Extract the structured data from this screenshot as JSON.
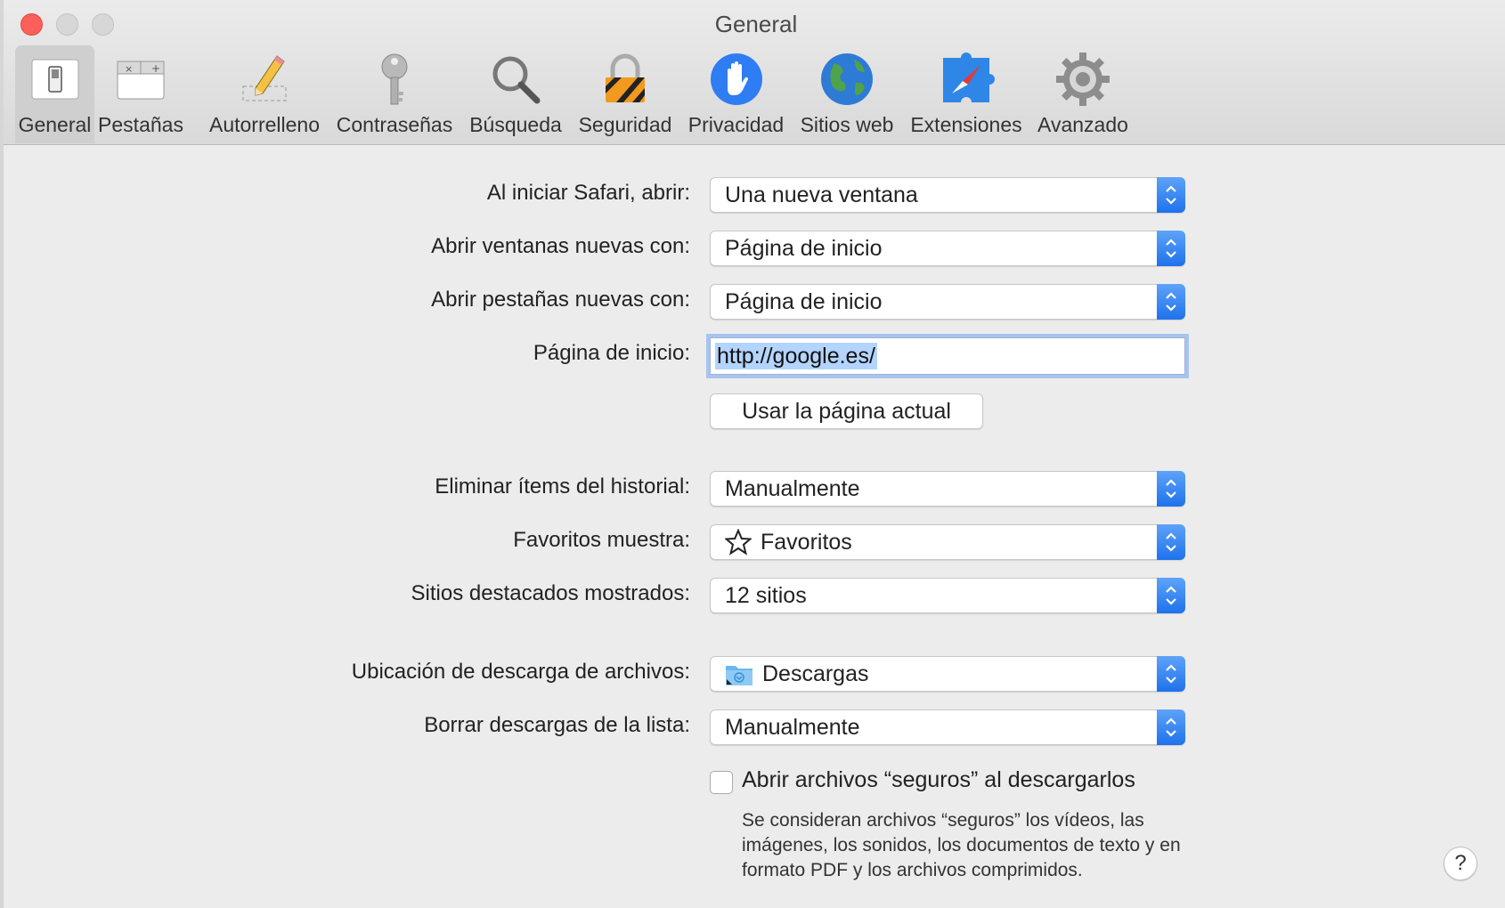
{
  "window": {
    "title": "General"
  },
  "toolbar": {
    "tabs": [
      {
        "label": "General",
        "icon": "general-switch-icon",
        "selected": true
      },
      {
        "label": "Pestañas",
        "icon": "tabs-icon",
        "selected": false
      },
      {
        "label": "Autorrelleno",
        "icon": "pencil-icon",
        "selected": false
      },
      {
        "label": "Contraseñas",
        "icon": "key-icon",
        "selected": false
      },
      {
        "label": "Búsqueda",
        "icon": "magnifier-icon",
        "selected": false
      },
      {
        "label": "Seguridad",
        "icon": "padlock-icon",
        "selected": false
      },
      {
        "label": "Privacidad",
        "icon": "hand-icon",
        "selected": false
      },
      {
        "label": "Sitios web",
        "icon": "globe-icon",
        "selected": false
      },
      {
        "label": "Extensiones",
        "icon": "puzzle-compass-icon",
        "selected": false
      },
      {
        "label": "Avanzado",
        "icon": "gear-icon",
        "selected": false
      }
    ]
  },
  "form": {
    "safari_opens_with": {
      "label": "Al iniciar Safari, abrir:",
      "value": "Una nueva ventana"
    },
    "new_windows_open_with": {
      "label": "Abrir ventanas nuevas con:",
      "value": "Página de inicio"
    },
    "new_tabs_open_with": {
      "label": "Abrir pestañas nuevas con:",
      "value": "Página de inicio"
    },
    "homepage": {
      "label": "Página de inicio:",
      "value": "http://google.es/"
    },
    "use_current_page": {
      "label": "Usar la página actual"
    },
    "remove_history": {
      "label": "Eliminar ítems del historial:",
      "value": "Manualmente"
    },
    "favorites_shows": {
      "label": "Favoritos muestra:",
      "value": "Favoritos",
      "icon": "star-icon"
    },
    "top_sites": {
      "label": "Sitios destacados mostrados:",
      "value": "12 sitios"
    },
    "download_location": {
      "label": "Ubicación de descarga de archivos:",
      "value": "Descargas",
      "icon": "downloads-folder-icon"
    },
    "remove_downloads": {
      "label": "Borrar descargas de la lista:",
      "value": "Manualmente"
    },
    "open_safe_files": {
      "label": "Abrir archivos “seguros” al descargarlos",
      "checked": false,
      "help": "Se consideran archivos “seguros” los vídeos, las imágenes, los sonidos, los documentos de texto y en formato PDF y los archivos comprimidos."
    }
  },
  "help_button": {
    "label": "?"
  },
  "colors": {
    "accent": "#1e72ec",
    "close": "#fc605b",
    "selection": "#b3d4fd",
    "focus_ring": "#a8c4f0"
  }
}
